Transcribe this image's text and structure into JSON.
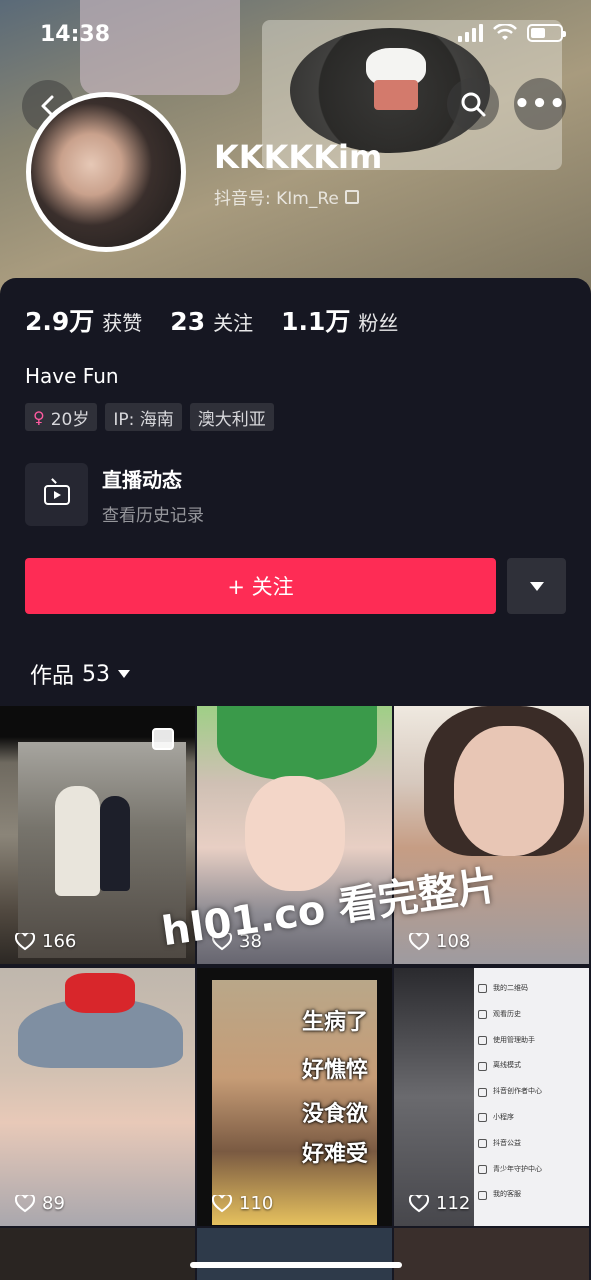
{
  "status_bar": {
    "time": "14:38",
    "icons": [
      "signal-icon",
      "wifi-icon",
      "battery-icon"
    ]
  },
  "header": {
    "back_icon": "back-arrow-icon",
    "search_icon": "search-icon",
    "more_label": "•••"
  },
  "profile": {
    "nickname": "KKKKKim",
    "douyin_id": "抖音号: KIm_Re",
    "stats": [
      {
        "num": "2.9万",
        "label": "获赞"
      },
      {
        "num": "23",
        "label": "关注"
      },
      {
        "num": "1.1万",
        "label": "粉丝"
      }
    ],
    "bio": "Have Fun",
    "tags": {
      "age": "20岁",
      "ip": "IP: 海南",
      "region": "澳大利亚"
    },
    "live": {
      "title": "直播动态",
      "subtitle": "查看历史记录"
    }
  },
  "actions": {
    "follow_label": "+ 关注"
  },
  "works": {
    "label": "作品",
    "count": "53"
  },
  "grid": [
    {
      "likes": "166"
    },
    {
      "likes": "38"
    },
    {
      "likes": "108"
    },
    {
      "likes": "89"
    },
    {
      "likes": "110"
    },
    {
      "likes": "112"
    }
  ],
  "cell5_overlay": [
    "生病了",
    "好憔悴",
    "没食欲",
    "好难受"
  ],
  "cell6_menu": [
    "我的二维码",
    "观看历史",
    "使用管理助手",
    "离线模式",
    "抖音创作者中心",
    "小程序",
    "抖音公益",
    "青少年守护中心",
    "我的客服"
  ],
  "watermark": "hl01.co 看完整片",
  "colors": {
    "accent": "#fe2c55",
    "bg": "#161722"
  }
}
